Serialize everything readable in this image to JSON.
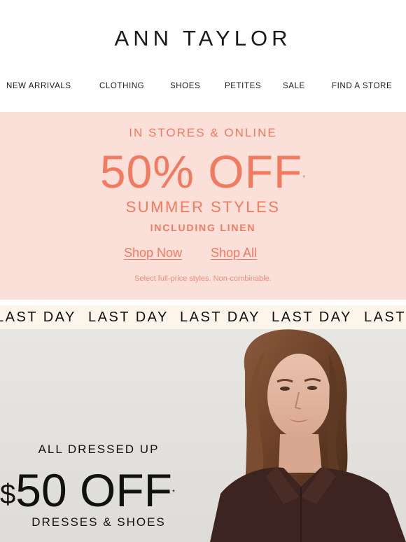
{
  "brand": {
    "logo": "ANN TAYLOR"
  },
  "nav": [
    {
      "label": "NEW ARRIVALS"
    },
    {
      "label": "CLOTHING"
    },
    {
      "label": "SHOES"
    },
    {
      "label": "PETITES"
    },
    {
      "label": "SALE"
    },
    {
      "label": "FIND A STORE"
    }
  ],
  "promo": {
    "kicker": "IN STORES & ONLINE",
    "headline": "50% OFF",
    "asterisk": "*",
    "sub1": "SUMMER STYLES",
    "sub2": "INCLUDING LINEN",
    "cta_shop_now": "Shop Now",
    "cta_shop_all": "Shop All",
    "fine_print": "Select full-price styles. Non-combinable.",
    "color": "#f27a5e",
    "background": "#fbdfd9"
  },
  "ticker": {
    "items": [
      "LAST DAY",
      "LAST DAY",
      "LAST DAY",
      "LAST DAY",
      "LAST DAY"
    ],
    "background": "#fbf5ea"
  },
  "hero": {
    "eyebrow": "ALL DRESSED UP",
    "currency": "$",
    "amount": "50 OFF",
    "asterisk": "*",
    "subline": "DRESSES & SHOES"
  }
}
